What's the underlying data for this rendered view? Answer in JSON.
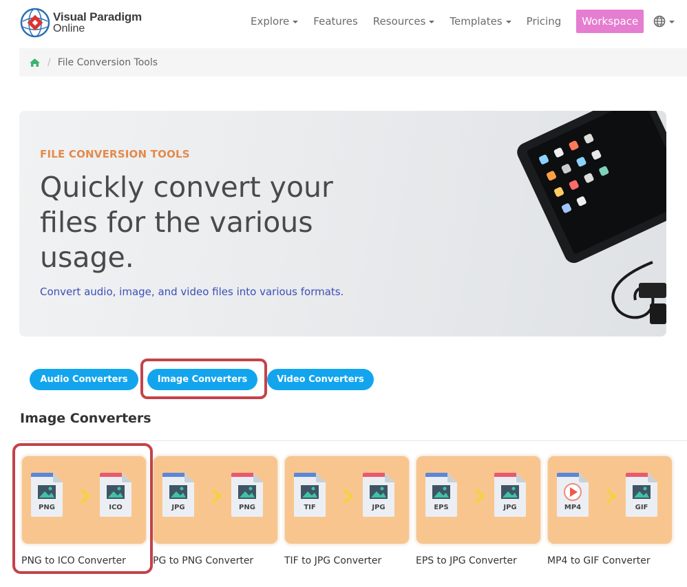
{
  "brand": {
    "line1": "Visual Paradigm",
    "line2": "Online"
  },
  "nav": {
    "items": [
      {
        "label": "Explore",
        "dropdown": true
      },
      {
        "label": "Features",
        "dropdown": false
      },
      {
        "label": "Resources",
        "dropdown": true
      },
      {
        "label": "Templates",
        "dropdown": true
      },
      {
        "label": "Pricing",
        "dropdown": false
      }
    ],
    "workspace": "Workspace"
  },
  "breadcrumb": {
    "current": "File Conversion Tools"
  },
  "hero": {
    "eyebrow": "FILE CONVERSION TOOLS",
    "title": "Quickly convert your files for the various usage.",
    "subtitle": "Convert audio, image, and video files into various formats."
  },
  "tabs": [
    "Audio Converters",
    "Image Converters",
    "Video Converters"
  ],
  "section": {
    "title": "Image Converters"
  },
  "cards": [
    {
      "from": "PNG",
      "to": "ICO",
      "label": "PNG to ICO Converter"
    },
    {
      "from": "JPG",
      "to": "PNG",
      "label": "PG to PNG Converter"
    },
    {
      "from": "TIF",
      "to": "JPG",
      "label": "TIF to JPG Converter"
    },
    {
      "from": "EPS",
      "to": "JPG",
      "label": "EPS to JPG Converter"
    },
    {
      "from": "MP4",
      "to": "GIF",
      "label": "MP4 to GIF Converter"
    }
  ],
  "colors": {
    "tab": "#12a5ee",
    "workspace": "#e57dd0",
    "eyebrow": "#e38a4a",
    "card": "#f9c58f",
    "highlight": "#c4424a"
  }
}
